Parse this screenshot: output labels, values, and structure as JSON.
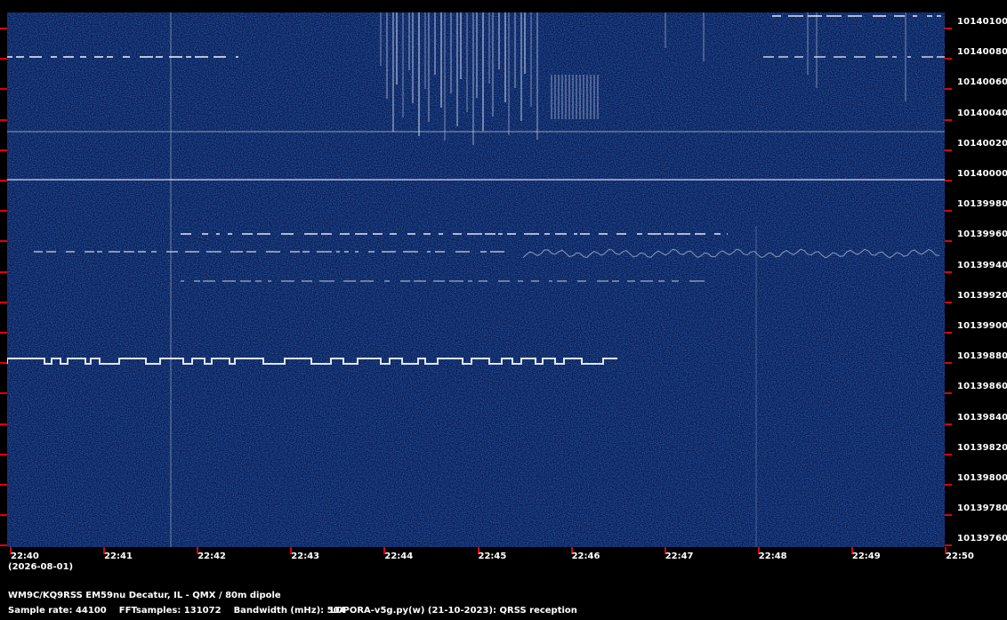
{
  "spectrogram": {
    "background": "#081c55",
    "trace_color": "#e8f0ff",
    "tick_color": "#e00000"
  },
  "freq_axis": {
    "labels": [
      "10140100",
      "10140080",
      "10140060",
      "10140040",
      "10140020",
      "10140000",
      "10139980",
      "10139960",
      "10139940",
      "10139920",
      "10139900",
      "10139880",
      "10139860",
      "10139840",
      "10139820",
      "10139800",
      "10139780",
      "10139760"
    ]
  },
  "time_axis": {
    "labels": [
      "22:40",
      "22:41",
      "22:42",
      "22:43",
      "22:44",
      "22:45",
      "22:46",
      "22:47",
      "22:48",
      "22:49",
      "22:50"
    ],
    "date": "(2026-08-01)"
  },
  "footer": {
    "station": "WM9C/KQ9RSS EM59nu Decatur, IL - QMX / 80m dipole",
    "sample_rate": "Sample rate: 44100",
    "fft_samples": "FFTsamples: 131072",
    "bandwidth": "Bandwidth (mHz): 504",
    "software": "LOPORA-v5g.py(w) (21-10-2023): QRSS reception"
  }
}
